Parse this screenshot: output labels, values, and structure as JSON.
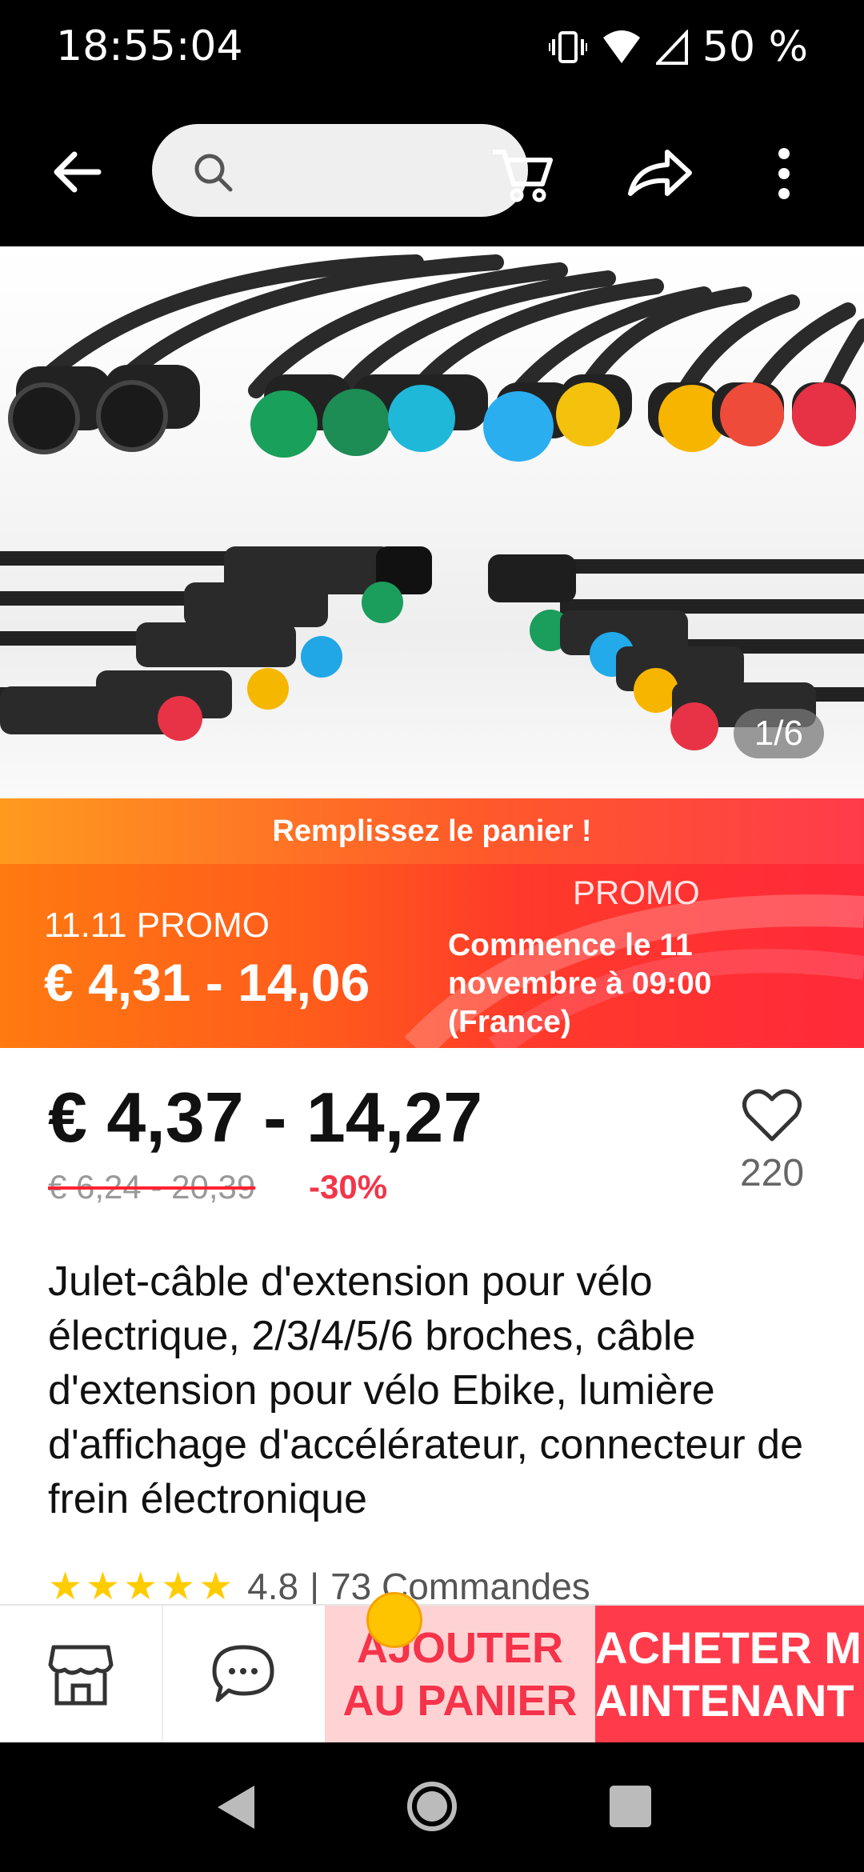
{
  "status_bar": {
    "time": "18:55:04",
    "battery": "50 %"
  },
  "search": {
    "placeholder": ""
  },
  "gallery": {
    "counter": "1/6"
  },
  "promo": {
    "strip_text": "Remplissez le panier !",
    "event_label": "11.11 PROMO",
    "event_price": "€ 4,31 - 14,06",
    "tag": "PROMO",
    "start_text": "Commence le 11 novembre à 09:00 (France)"
  },
  "price": {
    "current": "€ 4,37 - 14,27",
    "original": "€ 6,24 - 20,39",
    "discount": "-30%"
  },
  "wishlist": {
    "count": "220"
  },
  "product": {
    "title": "Julet-câble d'extension pour vélo électrique, 2/3/4/5/6 broches, câble d'extension pour vélo Ebike, lumière d'affichage d'accélérateur, connecteur de frein électronique",
    "rating": "4.8",
    "separator": "|",
    "orders": "73 Commandes",
    "stars": "★★★★★"
  },
  "actions": {
    "add_to_cart": "AJOUTER AU PANIER",
    "buy_now": "ACHETER MAINTENANT"
  },
  "colors": {
    "accent_red": "#ff3b4b",
    "promo_orange": "#ff7a10",
    "star_yellow": "#ffcc00"
  },
  "icons": [
    "back-arrow",
    "search",
    "cart",
    "share",
    "more-vertical",
    "heart",
    "store",
    "chat",
    "nav-back",
    "nav-home",
    "nav-recent"
  ]
}
